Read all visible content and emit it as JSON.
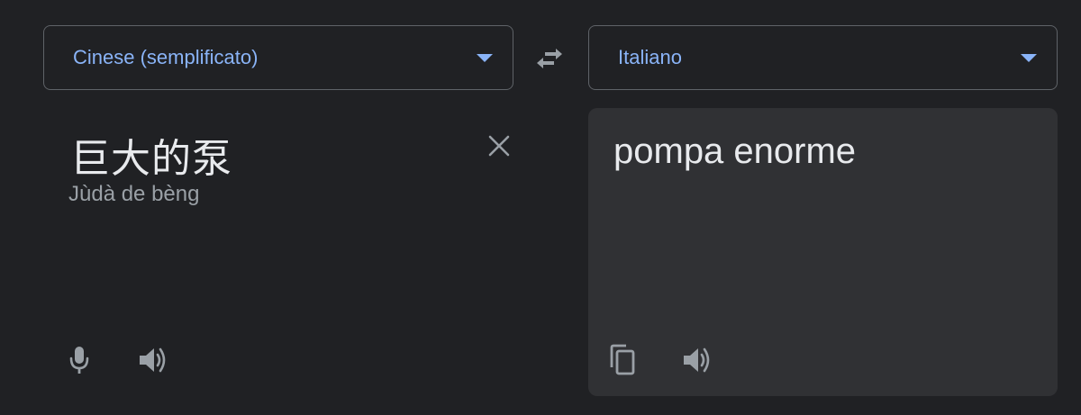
{
  "source_language": {
    "label": "Cinese (semplificato)"
  },
  "target_language": {
    "label": "Italiano"
  },
  "source": {
    "text": "巨大的泵",
    "transliteration": "Jùdà de bèng"
  },
  "translation": {
    "text": "pompa enorme"
  },
  "icons": {
    "swap": "swap-arrows-icon",
    "clear": "close-icon",
    "mic": "microphone-icon",
    "speaker": "speaker-icon",
    "copy": "copy-icon"
  },
  "colors": {
    "background": "#202124",
    "panel": "#303134",
    "accent": "#8ab4f8",
    "text": "#e8eaed",
    "muted": "#9aa0a6",
    "border": "#5f6368"
  }
}
